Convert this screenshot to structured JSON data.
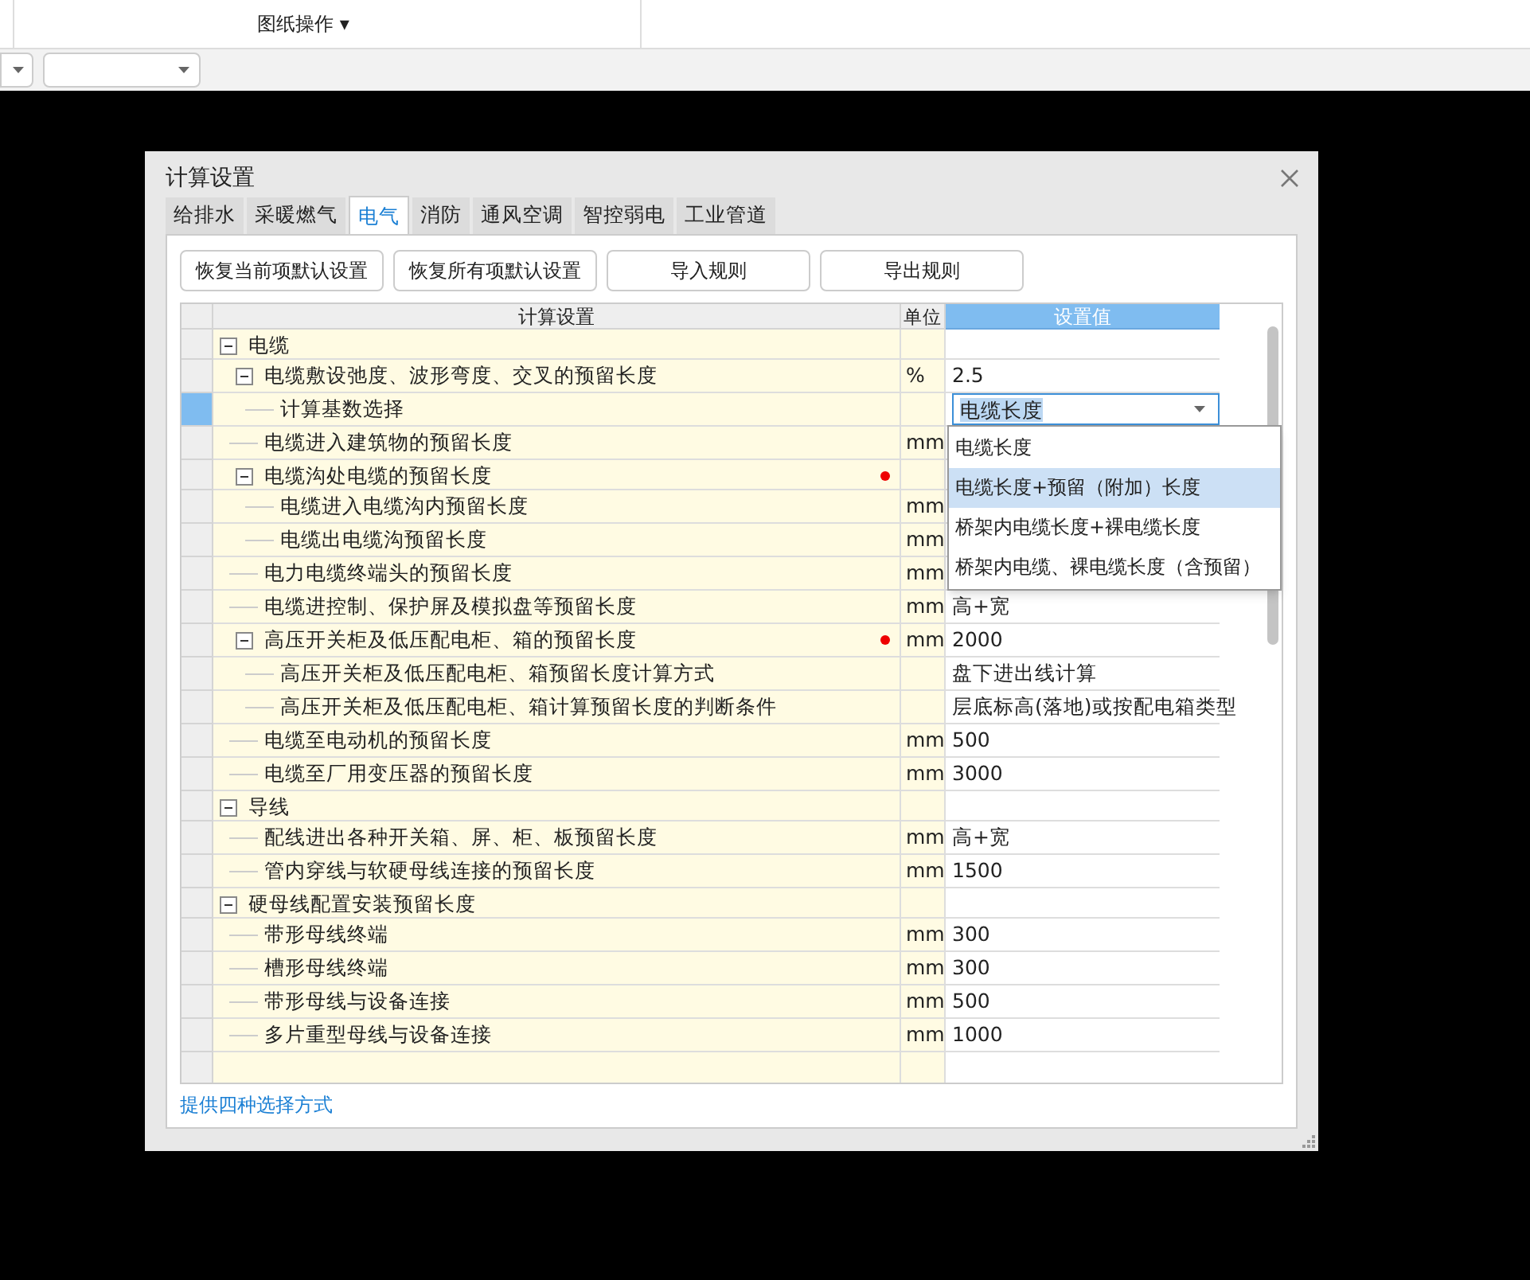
{
  "toolbar": {
    "menu": "图纸操作 ▾"
  },
  "dialog": {
    "title": "计算设置",
    "tabs": [
      {
        "label": "给排水",
        "selected": false
      },
      {
        "label": "采暖燃气",
        "selected": false
      },
      {
        "label": "电气",
        "selected": true
      },
      {
        "label": "消防",
        "selected": false
      },
      {
        "label": "通风空调",
        "selected": false
      },
      {
        "label": "智控弱电",
        "selected": false
      },
      {
        "label": "工业管道",
        "selected": false
      }
    ],
    "buttons": [
      "恢复当前项默认设置",
      "恢复所有项默认设置",
      "导入规则",
      "导出规则"
    ],
    "table": {
      "columns": [
        "计算设置",
        "单位",
        "设置值"
      ],
      "rows": [
        {
          "name": "电缆",
          "expanded": true,
          "selected": false,
          "marked": false,
          "children": [
            {
              "name": "电缆敷设弛度、波形弯度、交叉的预留长度",
              "unit": "%",
              "value": "2.5",
              "expanded": true,
              "selected": false,
              "marked": false,
              "children": [
                {
                  "name": "计算基数选择",
                  "value": "电缆长度",
                  "selected": true,
                  "marked": false,
                  "editing": true
                }
              ]
            },
            {
              "name": "电缆进入建筑物的预留长度",
              "unit": "mm",
              "selected": false,
              "marked": false
            },
            {
              "name": "电缆沟处电缆的预留长度",
              "expanded": true,
              "selected": false,
              "marked": true,
              "children": [
                {
                  "name": "电缆进入电缆沟内预留长度",
                  "unit": "mm",
                  "selected": false,
                  "marked": false
                },
                {
                  "name": "电缆出电缆沟预留长度",
                  "unit": "mm",
                  "selected": false,
                  "marked": false
                }
              ]
            },
            {
              "name": "电力电缆终端头的预留长度",
              "unit": "mm",
              "selected": false,
              "marked": false
            },
            {
              "name": "电缆进控制、保护屏及模拟盘等预留长度",
              "unit": "mm",
              "value": "高+宽",
              "selected": false,
              "marked": false
            },
            {
              "name": "高压开关柜及低压配电柜、箱的预留长度",
              "unit": "mm",
              "value": "2000",
              "expanded": true,
              "selected": false,
              "marked": true,
              "children": [
                {
                  "name": "高压开关柜及低压配电柜、箱预留长度计算方式",
                  "value": "盘下进出线计算",
                  "selected": false,
                  "marked": false
                },
                {
                  "name": "高压开关柜及低压配电柜、箱计算预留长度的判断条件",
                  "value": "层底标高(落地)或按配电箱类型",
                  "selected": false,
                  "marked": false
                }
              ]
            },
            {
              "name": "电缆至电动机的预留长度",
              "unit": "mm",
              "value": "500",
              "selected": false,
              "marked": false
            },
            {
              "name": "电缆至厂用变压器的预留长度",
              "unit": "mm",
              "value": "3000",
              "selected": false,
              "marked": false
            }
          ]
        },
        {
          "name": "导线",
          "expanded": true,
          "selected": false,
          "marked": false,
          "children": [
            {
              "name": "配线进出各种开关箱、屏、柜、板预留长度",
              "unit": "mm",
              "value": "高+宽",
              "selected": false,
              "marked": false
            },
            {
              "name": "管内穿线与软硬母线连接的预留长度",
              "unit": "mm",
              "value": "1500",
              "selected": false,
              "marked": false
            }
          ]
        },
        {
          "name": "硬母线配置安装预留长度",
          "expanded": true,
          "selected": false,
          "marked": false,
          "children": [
            {
              "name": "带形母线终端",
              "unit": "mm",
              "value": "300",
              "selected": false,
              "marked": false
            },
            {
              "name": "槽形母线终端",
              "unit": "mm",
              "value": "300",
              "selected": false,
              "marked": false
            },
            {
              "name": "带形母线与设备连接",
              "unit": "mm",
              "value": "500",
              "selected": false,
              "marked": false
            },
            {
              "name": "多片重型母线与设备连接",
              "unit": "mm",
              "value": "1000",
              "selected": false,
              "marked": false
            }
          ]
        }
      ]
    },
    "dropdown": {
      "options": [
        {
          "label": "电缆长度",
          "selected": false
        },
        {
          "label": "电缆长度+预留（附加）长度",
          "selected": true
        },
        {
          "label": "桥架内电缆长度+裸电缆长度",
          "selected": false
        },
        {
          "label": "桥架内电缆、裸电缆长度（含预留）",
          "selected": false
        }
      ]
    },
    "hint_link": "提供四种选择方式"
  }
}
